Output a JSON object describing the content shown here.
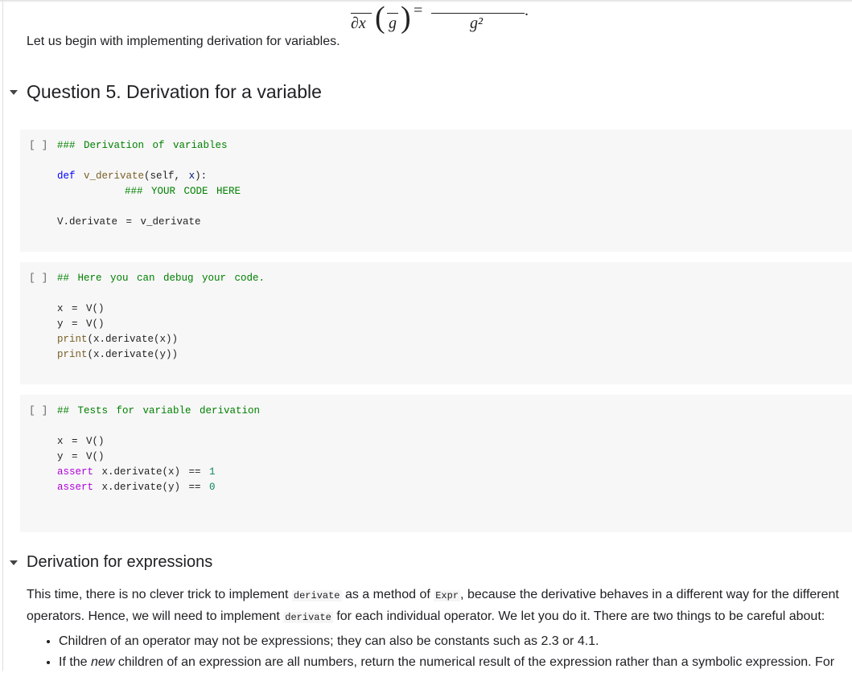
{
  "math": {
    "partial_x": "∂x",
    "g": "g",
    "equals": "=",
    "g_squared": "g²",
    "period": "."
  },
  "intro_text": "Let us begin with implementing derivation for variables.",
  "section1": {
    "title": "Question 5. Derivation for a variable"
  },
  "cells": [
    {
      "prompt": "[ ]",
      "lines": [
        [
          [
            "### Derivation of variables",
            "cm"
          ]
        ],
        [],
        [
          [
            "def",
            "kw"
          ],
          [
            " ",
            ""
          ],
          [
            "v_derivate",
            "fn"
          ],
          [
            "(self, ",
            ""
          ],
          [
            "x",
            "var"
          ],
          [
            "):",
            ""
          ]
        ],
        [
          [
            "        ",
            ""
          ],
          [
            "### YOUR CODE HERE",
            "cm"
          ]
        ],
        [],
        [
          [
            "V.derivate = v_derivate",
            ""
          ]
        ]
      ]
    },
    {
      "prompt": "[ ]",
      "lines": [
        [
          [
            "## Here you can debug your code.",
            "cm"
          ]
        ],
        [],
        [
          [
            "x = V()",
            ""
          ]
        ],
        [
          [
            "y = V()",
            ""
          ]
        ],
        [
          [
            "print",
            "fn"
          ],
          [
            "(x.derivate(x))",
            ""
          ]
        ],
        [
          [
            "print",
            "fn"
          ],
          [
            "(x.derivate(y))",
            ""
          ]
        ]
      ]
    },
    {
      "prompt": "[ ]",
      "lines": [
        [
          [
            "## Tests for variable derivation",
            "cm"
          ]
        ],
        [],
        [
          [
            "x = V()",
            ""
          ]
        ],
        [
          [
            "y = V()",
            ""
          ]
        ],
        [
          [
            "assert",
            "as"
          ],
          [
            " x.derivate(x) == ",
            ""
          ],
          [
            "1",
            "num"
          ]
        ],
        [
          [
            "assert",
            "as"
          ],
          [
            " x.derivate(y) == ",
            ""
          ],
          [
            "0",
            "num"
          ]
        ]
      ]
    }
  ],
  "section2": {
    "title": "Derivation for expressions",
    "p1": [
      "This time, there is no clever trick to implement ",
      "derivate",
      " as a method of ",
      "Expr",
      ", because the derivative behaves in a different way for the different operators. Hence, we will need to implement ",
      "derivate",
      " for each individual operator. We let you do it. There are two things to be careful about:"
    ],
    "bullets": [
      {
        "text": "Children of an operator may not be expressions; they can also be constants such as 2.3 or 4.1."
      },
      {
        "pre": "If the ",
        "em": "new",
        "post": " children of an expression are all numbers, return the numerical result of the expression rather than a symbolic expression. For"
      }
    ]
  }
}
